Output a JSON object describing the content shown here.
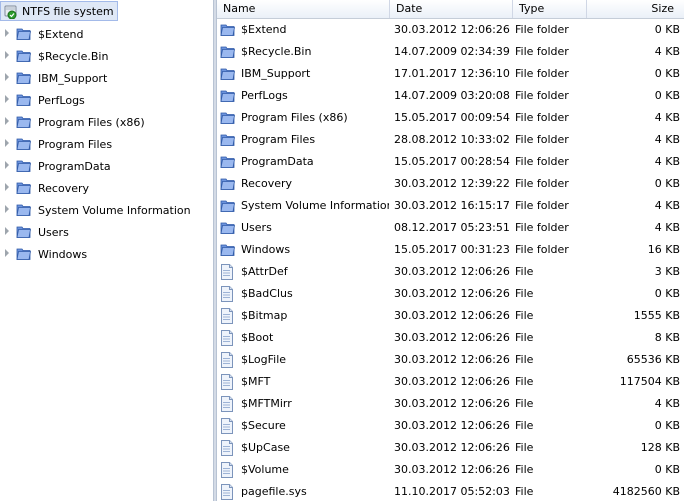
{
  "tree": {
    "root_label": "NTFS file system",
    "items": [
      {
        "label": "$Extend"
      },
      {
        "label": "$Recycle.Bin"
      },
      {
        "label": "IBM_Support"
      },
      {
        "label": "PerfLogs"
      },
      {
        "label": "Program Files (x86)"
      },
      {
        "label": "Program Files"
      },
      {
        "label": "ProgramData"
      },
      {
        "label": "Recovery"
      },
      {
        "label": "System Volume Information"
      },
      {
        "label": "Users"
      },
      {
        "label": "Windows"
      }
    ]
  },
  "list": {
    "columns": {
      "name": "Name",
      "date": "Date",
      "type": "Type",
      "size": "Size"
    },
    "rows": [
      {
        "icon": "folder-icon",
        "name": "$Extend",
        "date": "30.03.2012 12:06:26",
        "type": "File folder",
        "size": "0 KB"
      },
      {
        "icon": "folder-icon",
        "name": "$Recycle.Bin",
        "date": "14.07.2009 02:34:39",
        "type": "File folder",
        "size": "4 KB"
      },
      {
        "icon": "folder-icon",
        "name": "IBM_Support",
        "date": "17.01.2017 12:36:10",
        "type": "File folder",
        "size": "0 KB"
      },
      {
        "icon": "folder-icon",
        "name": "PerfLogs",
        "date": "14.07.2009 03:20:08",
        "type": "File folder",
        "size": "0 KB"
      },
      {
        "icon": "folder-icon",
        "name": "Program Files (x86)",
        "date": "15.05.2017 00:09:54",
        "type": "File folder",
        "size": "4 KB"
      },
      {
        "icon": "folder-icon",
        "name": "Program Files",
        "date": "28.08.2012 10:33:02",
        "type": "File folder",
        "size": "4 KB"
      },
      {
        "icon": "folder-icon",
        "name": "ProgramData",
        "date": "15.05.2017 00:28:54",
        "type": "File folder",
        "size": "4 KB"
      },
      {
        "icon": "folder-icon",
        "name": "Recovery",
        "date": "30.03.2012 12:39:22",
        "type": "File folder",
        "size": "0 KB"
      },
      {
        "icon": "folder-icon",
        "name": "System Volume Information",
        "date": "30.03.2012 16:15:17",
        "type": "File folder",
        "size": "4 KB"
      },
      {
        "icon": "folder-icon",
        "name": "Users",
        "date": "08.12.2017 05:23:51",
        "type": "File folder",
        "size": "4 KB"
      },
      {
        "icon": "folder-icon",
        "name": "Windows",
        "date": "15.05.2017 00:31:23",
        "type": "File folder",
        "size": "16 KB"
      },
      {
        "icon": "file-icon",
        "name": "$AttrDef",
        "date": "30.03.2012 12:06:26",
        "type": "File",
        "size": "3 KB"
      },
      {
        "icon": "file-icon",
        "name": "$BadClus",
        "date": "30.03.2012 12:06:26",
        "type": "File",
        "size": "0 KB"
      },
      {
        "icon": "file-icon",
        "name": "$Bitmap",
        "date": "30.03.2012 12:06:26",
        "type": "File",
        "size": "1555 KB"
      },
      {
        "icon": "file-icon",
        "name": "$Boot",
        "date": "30.03.2012 12:06:26",
        "type": "File",
        "size": "8 KB"
      },
      {
        "icon": "file-icon",
        "name": "$LogFile",
        "date": "30.03.2012 12:06:26",
        "type": "File",
        "size": "65536 KB"
      },
      {
        "icon": "file-icon",
        "name": "$MFT",
        "date": "30.03.2012 12:06:26",
        "type": "File",
        "size": "117504 KB"
      },
      {
        "icon": "file-icon",
        "name": "$MFTMirr",
        "date": "30.03.2012 12:06:26",
        "type": "File",
        "size": "4 KB"
      },
      {
        "icon": "file-icon",
        "name": "$Secure",
        "date": "30.03.2012 12:06:26",
        "type": "File",
        "size": "0 KB"
      },
      {
        "icon": "file-icon",
        "name": "$UpCase",
        "date": "30.03.2012 12:06:26",
        "type": "File",
        "size": "128 KB"
      },
      {
        "icon": "file-icon",
        "name": "$Volume",
        "date": "30.03.2012 12:06:26",
        "type": "File",
        "size": "0 KB"
      },
      {
        "icon": "file-icon",
        "name": "pagefile.sys",
        "date": "11.10.2017 05:52:03",
        "type": "File",
        "size": "4182560 KB"
      }
    ]
  },
  "colors": {
    "selection_bg": "#dfe8f6",
    "selection_border": "#a3bae9",
    "folder_blue": "#5f87d6",
    "header_border": "#c5cdd8"
  }
}
